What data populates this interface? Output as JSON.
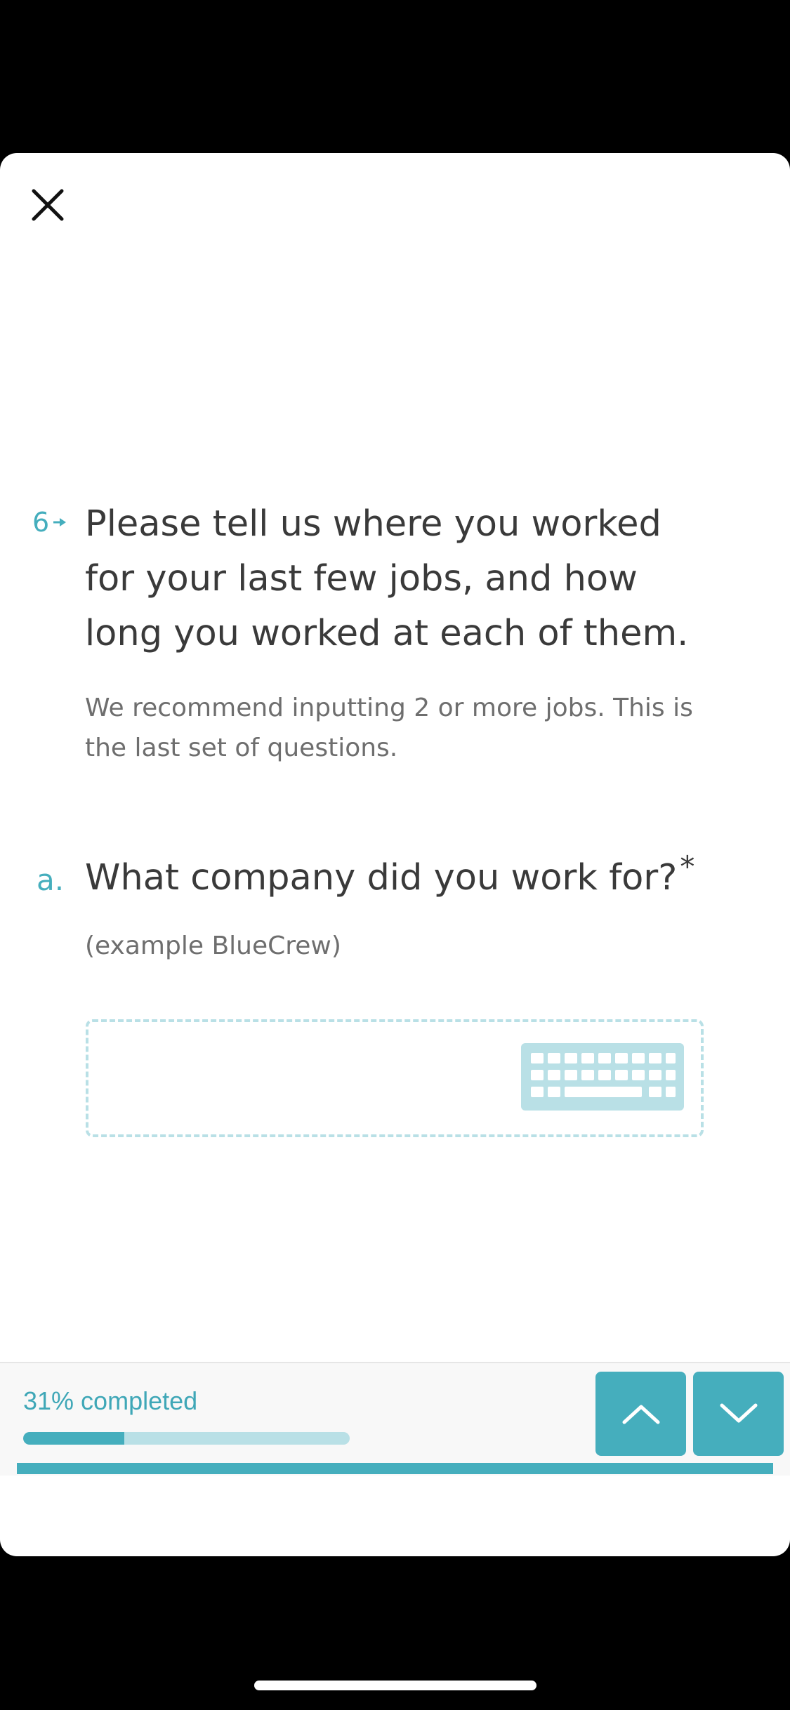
{
  "question": {
    "number": "6",
    "title": "Please tell us where you worked for your last few jobs, and how long you worked at each of them.",
    "description": "We recommend inputting 2 or more jobs. This is the last set of questions."
  },
  "sub_question": {
    "letter": "a.",
    "title": "What company did you work for?",
    "required_marker": "*",
    "hint": "(example BlueCrew)"
  },
  "answer": {
    "value": "",
    "icon": "keyboard-icon"
  },
  "footer": {
    "progress_label": "31% completed",
    "progress_fraction": 0.31,
    "up_icon": "chevron-up-icon",
    "down_icon": "chevron-down-icon"
  },
  "colors": {
    "accent": "#45aebd",
    "accent_light": "#b9e0e6",
    "text": "#3a3a3a",
    "muted": "#6e6e6e"
  }
}
